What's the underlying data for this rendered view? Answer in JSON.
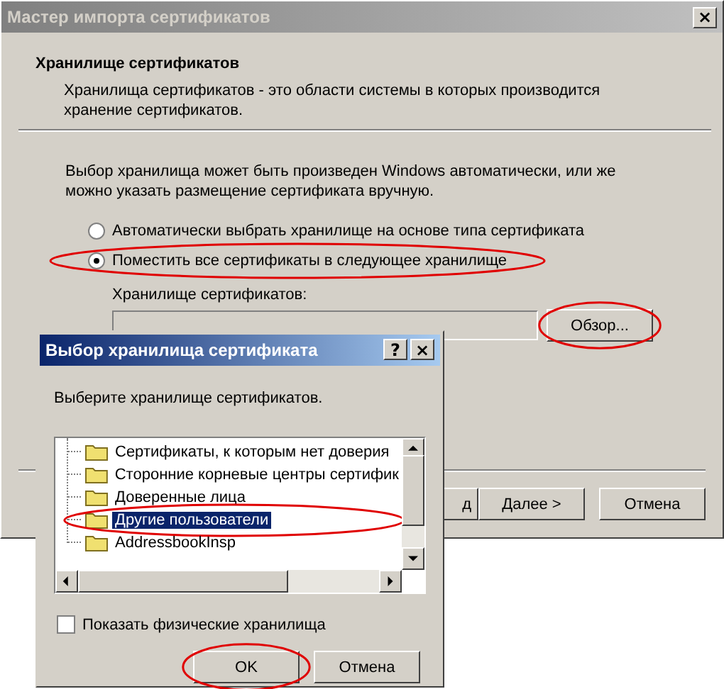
{
  "window": {
    "title": "Мастер импорта сертификатов",
    "close": "×"
  },
  "header": {
    "title": "Хранилище сертификатов",
    "description": "Хранилища сертификатов - это области системы в которых производится хранение сертификатов."
  },
  "intro": "Выбор хранилища может быть произведен Windows автоматически, или же можно указать размещение сертификата вручную.",
  "options": [
    {
      "label": "Автоматически выбрать хранилище на основе типа сертификата",
      "selected": false,
      "circled": false
    },
    {
      "label": "Поместить все сертификаты в следующее хранилище",
      "selected": true,
      "circled": true
    }
  ],
  "store_field": {
    "label": "Хранилище сертификатов:",
    "browse": "Обзор...",
    "browse_circled": true
  },
  "buttons": [
    {
      "label": "д"
    },
    {
      "label": "Далее >"
    },
    {
      "label": "Отмена"
    }
  ],
  "dialog": {
    "title": "Выбор хранилища сертификата",
    "help": "?",
    "close": "×",
    "prompt": "Выберите хранилище сертификатов.",
    "tree": [
      {
        "label": "Сертификаты, к которым нет доверия",
        "selected": false,
        "circled": false
      },
      {
        "label": "Сторонние корневые центры сертифик",
        "selected": false,
        "circled": false
      },
      {
        "label": "Доверенные лица",
        "selected": false,
        "circled": false
      },
      {
        "label": "Другие пользователи",
        "selected": true,
        "circled": true
      },
      {
        "label": "AddressbookInsp",
        "selected": false,
        "circled": false
      }
    ],
    "show_physical": {
      "label": "Показать физические хранилища",
      "checked": false
    },
    "buttons": [
      {
        "label": "OK",
        "circled": true
      },
      {
        "label": "Отмена",
        "circled": false
      }
    ]
  }
}
